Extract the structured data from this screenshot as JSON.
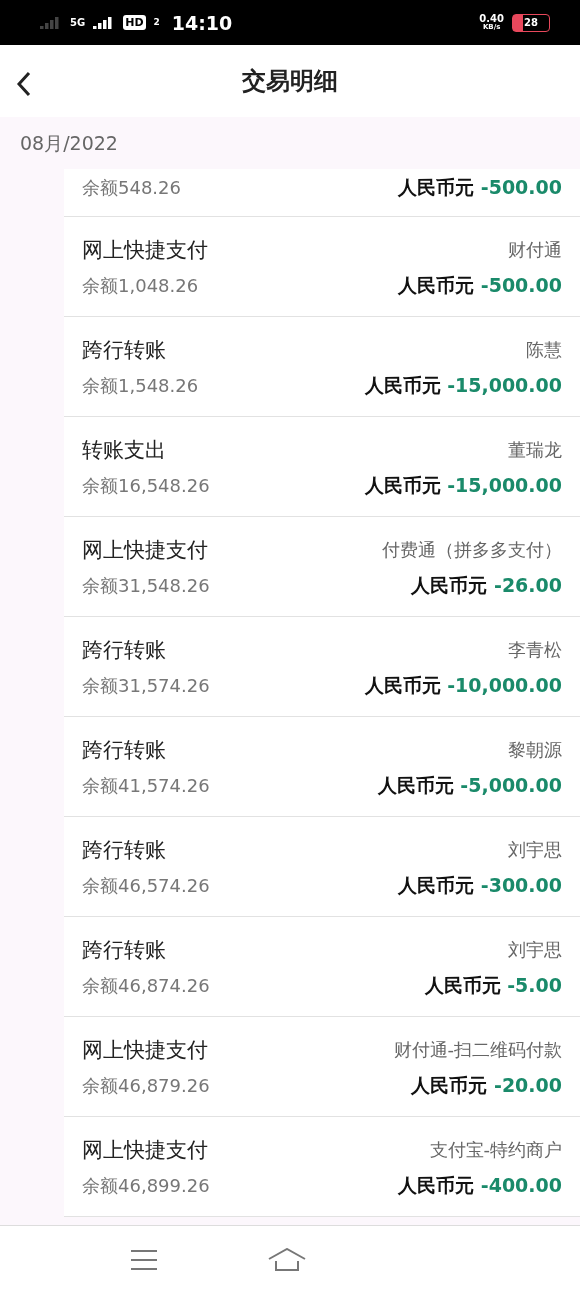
{
  "status_bar": {
    "network": "5G",
    "hd": "HD",
    "hd_sub": "2",
    "time": "14:10",
    "speed": "0.40",
    "speed_unit": "KB/s",
    "battery": "28",
    "battery_low": true
  },
  "header": {
    "title": "交易明细"
  },
  "month": "08月/2022",
  "transactions": [
    {
      "balance": "余额548.26",
      "currency": "人民币元",
      "amount": "-500.00"
    },
    {
      "type": "网上快捷支付",
      "counterparty": "财付通",
      "balance": "余额1,048.26",
      "currency": "人民币元",
      "amount": "-500.00"
    },
    {
      "type": "跨行转账",
      "counterparty": "陈慧",
      "balance": "余额1,548.26",
      "currency": "人民币元",
      "amount": "-15,000.00"
    },
    {
      "type": "转账支出",
      "counterparty": "董瑞龙",
      "balance": "余额16,548.26",
      "currency": "人民币元",
      "amount": "-15,000.00"
    },
    {
      "type": "网上快捷支付",
      "counterparty": "付费通（拼多多支付）",
      "balance": "余额31,548.26",
      "currency": "人民币元",
      "amount": "-26.00"
    },
    {
      "type": "跨行转账",
      "counterparty": "李青松",
      "balance": "余额31,574.26",
      "currency": "人民币元",
      "amount": "-10,000.00"
    },
    {
      "type": "跨行转账",
      "counterparty": "黎朝源",
      "balance": "余额41,574.26",
      "currency": "人民币元",
      "amount": "-5,000.00"
    },
    {
      "type": "跨行转账",
      "counterparty": "刘宇思",
      "balance": "余额46,574.26",
      "currency": "人民币元",
      "amount": "-300.00"
    },
    {
      "type": "跨行转账",
      "counterparty": "刘宇思",
      "balance": "余额46,874.26",
      "currency": "人民币元",
      "amount": "-5.00"
    },
    {
      "type": "网上快捷支付",
      "counterparty": "财付通-扫二维码付款",
      "balance": "余额46,879.26",
      "currency": "人民币元",
      "amount": "-20.00"
    },
    {
      "type": "网上快捷支付",
      "counterparty": "支付宝-特约商户",
      "balance": "余额46,899.26",
      "currency": "人民币元",
      "amount": "-400.00"
    }
  ]
}
